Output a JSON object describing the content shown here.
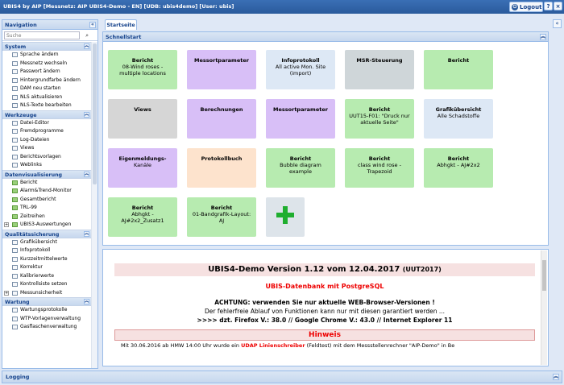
{
  "header": {
    "title": "UBIS4 by AIP [Messnetz: AIP UBIS4-Demo - EN] [UDB: ubis4demo] [User: ubis]",
    "logout_label": "Logout",
    "help_label": "?",
    "close_label": "×"
  },
  "navigation": {
    "title": "Navigation",
    "search_placeholder": "Suche",
    "groups": [
      {
        "label": "System",
        "items": [
          "Sprache ändern",
          "Messnetz wechseln",
          "Passwort ändern",
          "Hintergrundfarbe ändern",
          "DAM neu starten",
          "NLS aktualisieren",
          "NLS-Texte bearbeiten"
        ]
      },
      {
        "label": "Werkzeuge",
        "items": [
          "Datei-Editor",
          "Fremdprogramme",
          "Log-Dateien",
          "Views",
          "Berichtsvorlagen",
          "Weblinks"
        ]
      },
      {
        "label": "Datenvisualisierung",
        "items": [
          "Bericht",
          "Alarm&Trend-Monitor",
          "Gesamtbericht",
          "TRL-99",
          "Zeitreihen",
          "UBIS3-Auswertungen"
        ]
      },
      {
        "label": "Qualitätssicherung",
        "items": [
          "Grafikübersicht",
          "Infoprotokoll",
          "Kurzzeitmittelwerte",
          "Korrektur",
          "Kalibrierwerte",
          "Kontrollsiste setzen",
          "Messunsicherheit"
        ]
      },
      {
        "label": "Wartung",
        "items": [
          "Wartungsprotokolle",
          "WTP-Vorlagenverwaltung",
          "Gasflaschenverwaltung"
        ]
      }
    ]
  },
  "tabs": {
    "startseite": "Startseite"
  },
  "quickstart": {
    "title": "Schnellstart",
    "tiles": [
      {
        "title": "Bericht",
        "sub": "08-Wind roses -",
        "sub2": "multiple locations"
      },
      {
        "title": "Messortparameter",
        "sub": "",
        "sub2": ""
      },
      {
        "title": "Infoprotokoll",
        "sub": "All active Mon. Site",
        "sub2": "(import)"
      },
      {
        "title": "MSR-Steuerung",
        "sub": "",
        "sub2": ""
      },
      {
        "title": "Bericht",
        "sub": "",
        "sub2": ""
      },
      {
        "title": "Views",
        "sub": "",
        "sub2": ""
      },
      {
        "title": "Berechnungen",
        "sub": "",
        "sub2": ""
      },
      {
        "title": "Messortparameter",
        "sub": "",
        "sub2": ""
      },
      {
        "title": "Bericht",
        "sub": "UUT15-F01: \"Druck nur",
        "sub2": "aktuelle Seite\""
      },
      {
        "title": "Grafikübersicht",
        "sub": "Alle Schadstoffe",
        "sub2": ""
      },
      {
        "title": "Eigenmeldungs-",
        "sub": "Kanäle",
        "sub2": ""
      },
      {
        "title": "Protokollbuch",
        "sub": "",
        "sub2": ""
      },
      {
        "title": "Bericht",
        "sub": "Bubble diagram",
        "sub2": "example"
      },
      {
        "title": "Bericht",
        "sub": "class wind rose -",
        "sub2": "Trapezoid"
      },
      {
        "title": "Bericht",
        "sub": "Abhgkt - AJ#2x2",
        "sub2": ""
      },
      {
        "title": "Bericht",
        "sub": "Abhgkt -",
        "sub2": "AJ#2x2_Zusatz1"
      },
      {
        "title": "Bericht",
        "sub": "01-Bandgrafik-Layout:",
        "sub2": "AJ"
      },
      {
        "title": "+",
        "sub": "",
        "sub2": ""
      }
    ]
  },
  "info": {
    "version_title": "UBIS4-Demo Version 1.12 vom 12.04.2017",
    "version_code": "(UUT2017)",
    "db_line": "UBIS-Datenbank mit PostgreSQL",
    "achtung1": "ACHTUNG:  verwenden Sie nur  aktuelle WEB-Browser-Versionen !",
    "achtung2": "Der fehlerfreie Ablauf von Funktionen kann nur mit diesen garantiert werden ...",
    "achtung3": ">>>> dzt. Firefox V.: 38.0 //  Google Chrome V.: 43.0  //   Internet Explorer 11",
    "hinweis": "Hinweis",
    "hinweis_text_a": "Mit 30.06.2016 ab HMW 14:00 Uhr wurde ein ",
    "hinweis_text_red": "UDAP Linienschreiber",
    "hinweis_text_b": " (Feldtest) mit dem Messstellenrechner \"AIP-Demo\" in Be"
  },
  "logging": {
    "title": "Logging"
  }
}
